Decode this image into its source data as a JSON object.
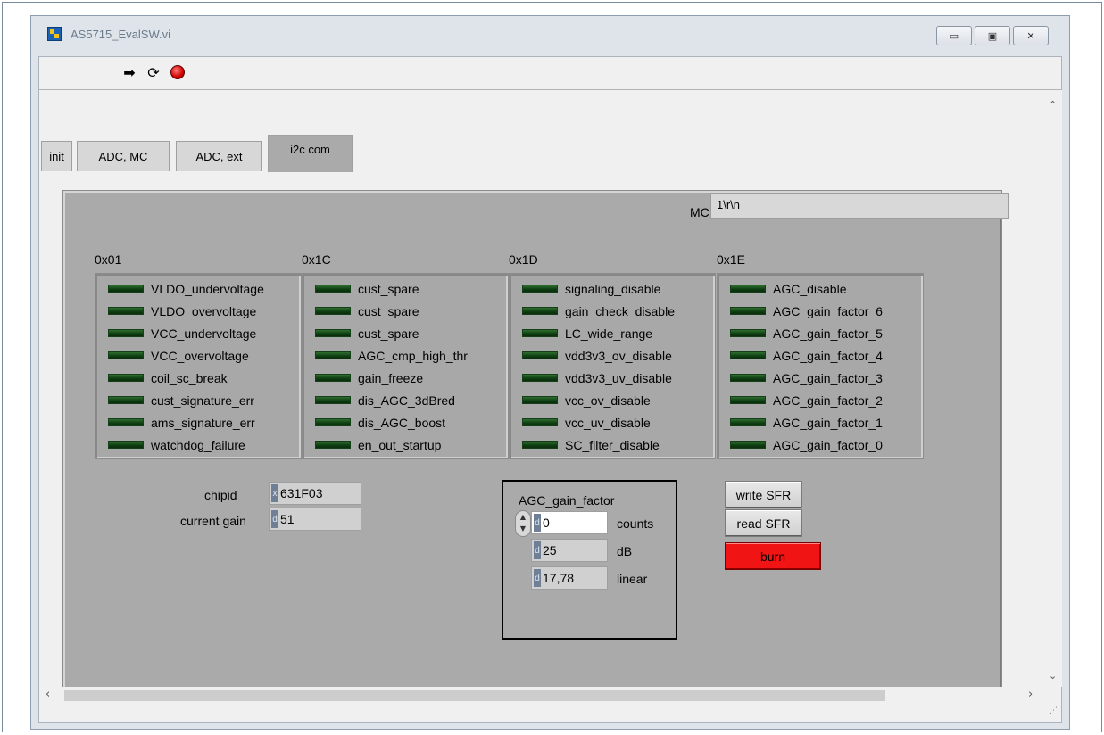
{
  "window": {
    "title": "AS5715_EvalSW.vi",
    "controls": [
      "minimize",
      "maximize",
      "close"
    ]
  },
  "toolbar": {
    "icons": [
      "run-arrow-icon",
      "run-continuously-icon",
      "abort-stop-icon"
    ]
  },
  "tabs": [
    {
      "label": "init",
      "active": false
    },
    {
      "label": "ADC, MC",
      "active": false
    },
    {
      "label": "ADC, ext",
      "active": false
    },
    {
      "label": "i2c com",
      "active": true
    }
  ],
  "mc": {
    "label": "MC",
    "value": "1\\r\\n"
  },
  "registers": [
    {
      "title": "0x01",
      "bits": [
        "VLDO_undervoltage",
        "VLDO_overvoltage",
        "VCC_undervoltage",
        "VCC_overvoltage",
        "coil_sc_break",
        "cust_signature_err",
        "ams_signature_err",
        "watchdog_failure"
      ]
    },
    {
      "title": "0x1C",
      "bits": [
        "cust_spare",
        "cust_spare",
        "cust_spare",
        "AGC_cmp_high_thr",
        "gain_freeze",
        "dis_AGC_3dBred",
        "dis_AGC_boost",
        "en_out_startup"
      ]
    },
    {
      "title": "0x1D",
      "bits": [
        "signaling_disable",
        "gain_check_disable",
        "LC_wide_range",
        "vdd3v3_ov_disable",
        "vdd3v3_uv_disable",
        "vcc_ov_disable",
        "vcc_uv_disable",
        "SC_filter_disable"
      ]
    },
    {
      "title": "0x1E",
      "bits": [
        "AGC_disable",
        "AGC_gain_factor_6",
        "AGC_gain_factor_5",
        "AGC_gain_factor_4",
        "AGC_gain_factor_3",
        "AGC_gain_factor_2",
        "AGC_gain_factor_1",
        "AGC_gain_factor_0"
      ]
    }
  ],
  "chipid": {
    "label": "chipid",
    "radix": "x",
    "value": "631F03"
  },
  "current_gain": {
    "label": "current gain",
    "radix": "d",
    "value": "51"
  },
  "agc": {
    "title": "AGC_gain_factor",
    "counts": {
      "radix": "d",
      "value": "0",
      "unit": "counts"
    },
    "db": {
      "radix": "d",
      "value": "25",
      "unit": "dB"
    },
    "linear": {
      "radix": "d",
      "value": "17,78",
      "unit": "linear"
    }
  },
  "buttons": {
    "write": "write SFR",
    "read": "read SFR",
    "burn": "burn"
  },
  "colors": {
    "panel": "#aaaaaa",
    "led_off": "#1a4d1c",
    "burn": "#f01414",
    "radix": "#6f7f96"
  }
}
